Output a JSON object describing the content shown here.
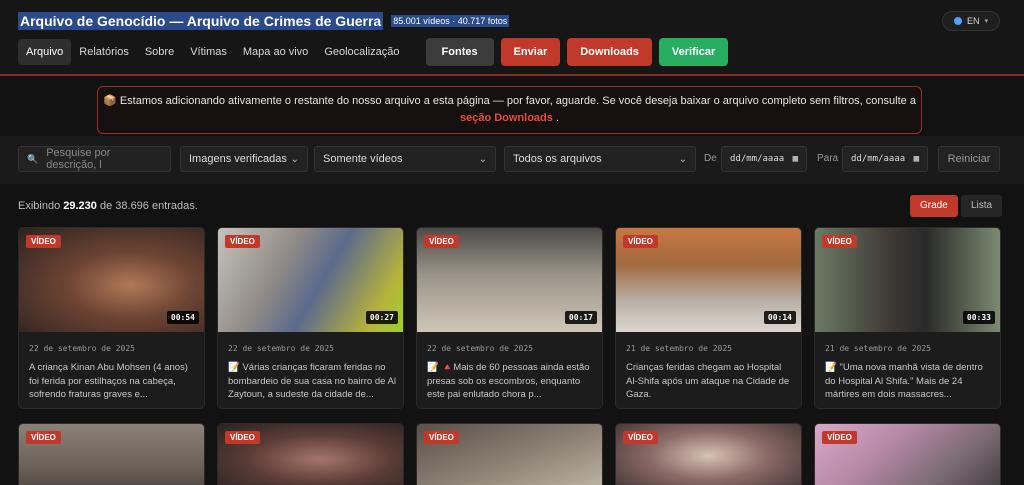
{
  "header": {
    "title": "Arquivo de Genocídio — Arquivo de Crimes de Guerra",
    "stats": "85.001 vídeos · 40.717 fotos",
    "lang": "EN"
  },
  "nav": {
    "items": [
      "Arquivo",
      "Relatórios",
      "Sobre",
      "Vítimas",
      "Mapa ao vivo",
      "Geolocalização"
    ],
    "buttons": [
      "Fontes",
      "Enviar",
      "Downloads",
      "Verificar"
    ]
  },
  "notice": {
    "icon": "📦",
    "text": "Estamos adicionando ativamente o restante do nosso arquivo a esta página — por favor, aguarde. Se você deseja baixar o arquivo completo sem filtros, consulte a",
    "link": "seção Downloads",
    "end": "."
  },
  "filters": {
    "search_placeholder": "Pesquise por descrição, l",
    "select1": "Imagens verificadas",
    "select2": "Somente vídeos",
    "select3": "Todos os arquivos",
    "from_label": "De",
    "from_value": "dd/mm/aaaa",
    "to_label": "Para",
    "to_value": "dd/mm/aaaa",
    "reset": "Reiniciar"
  },
  "results": {
    "prefix": "Exibindo",
    "shown": "29.230",
    "middle": "de 38.696 entradas.",
    "grid_label": "Grade",
    "list_label": "Lista"
  },
  "badge": "VÍDEO",
  "cards": [
    {
      "duration": "00:54",
      "date": "22 de setembro de 2025",
      "desc": "A criança Kinan Abu Mohsen (4 anos) foi ferida por estilhaços na cabeça, sofrendo fraturas graves e..."
    },
    {
      "duration": "00:27",
      "date": "22 de setembro de 2025",
      "desc": "📝 Várias crianças ficaram feridas no bombardeio de sua casa no bairro de Al Zaytoun, a sudeste da cidade de..."
    },
    {
      "duration": "00:17",
      "date": "22 de setembro de 2025",
      "desc": "📝 🔺Mais de 60 pessoas ainda estão presas sob os escombros, enquanto este pai enlutado chora p..."
    },
    {
      "duration": "00:14",
      "date": "21 de setembro de 2025",
      "desc": "Crianças feridas chegam ao Hospital Al-Shifa após um ataque na Cidade de Gaza."
    },
    {
      "duration": "00:33",
      "date": "21 de setembro de 2025",
      "desc": "📝 \"Uma nova manhã vista de dentro do Hospital Al Shifa.\" Mais de 24 mártires em dois massacres..."
    }
  ]
}
